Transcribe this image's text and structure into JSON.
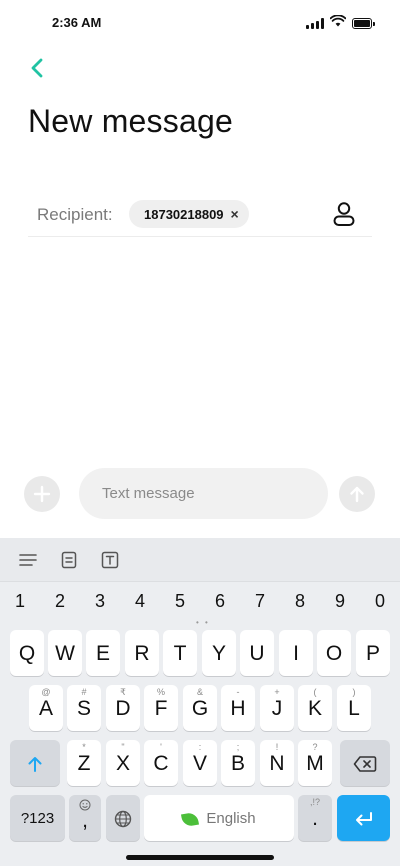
{
  "status_bar": {
    "time": "2:36 AM"
  },
  "header": {
    "title": "New message"
  },
  "recipient": {
    "label": "Recipient:",
    "number": "18730218809",
    "remove_glyph": "×"
  },
  "compose": {
    "placeholder": "Text message"
  },
  "keyboard": {
    "numbers": [
      "1",
      "2",
      "3",
      "4",
      "5",
      "6",
      "7",
      "8",
      "9",
      "0"
    ],
    "row1": [
      "Q",
      "W",
      "E",
      "R",
      "T",
      "Y",
      "U",
      "I",
      "O",
      "P"
    ],
    "row2": [
      "A",
      "S",
      "D",
      "F",
      "G",
      "H",
      "J",
      "K",
      "L"
    ],
    "row2_hints": [
      "@",
      "#",
      "₹",
      "%",
      "&",
      "-",
      "+",
      "(",
      ")"
    ],
    "row3": [
      "Z",
      "X",
      "C",
      "V",
      "B",
      "N",
      "M"
    ],
    "row3_hints": [
      "*",
      "\"",
      "'",
      ":",
      ";",
      "!",
      "?"
    ],
    "symbols_label": "?123",
    "comma_label": ",",
    "space_label": "English",
    "period_label": ".",
    "period_hint": ",!?",
    "icons": [
      "shift-icon",
      "backspace-icon",
      "emoji-icon",
      "globe-icon",
      "enter-icon",
      "menu-icon",
      "clipboard-icon",
      "text-format-icon"
    ]
  },
  "colors": {
    "accent_green": "#21c3a3",
    "enter_blue": "#1ea7f2"
  }
}
